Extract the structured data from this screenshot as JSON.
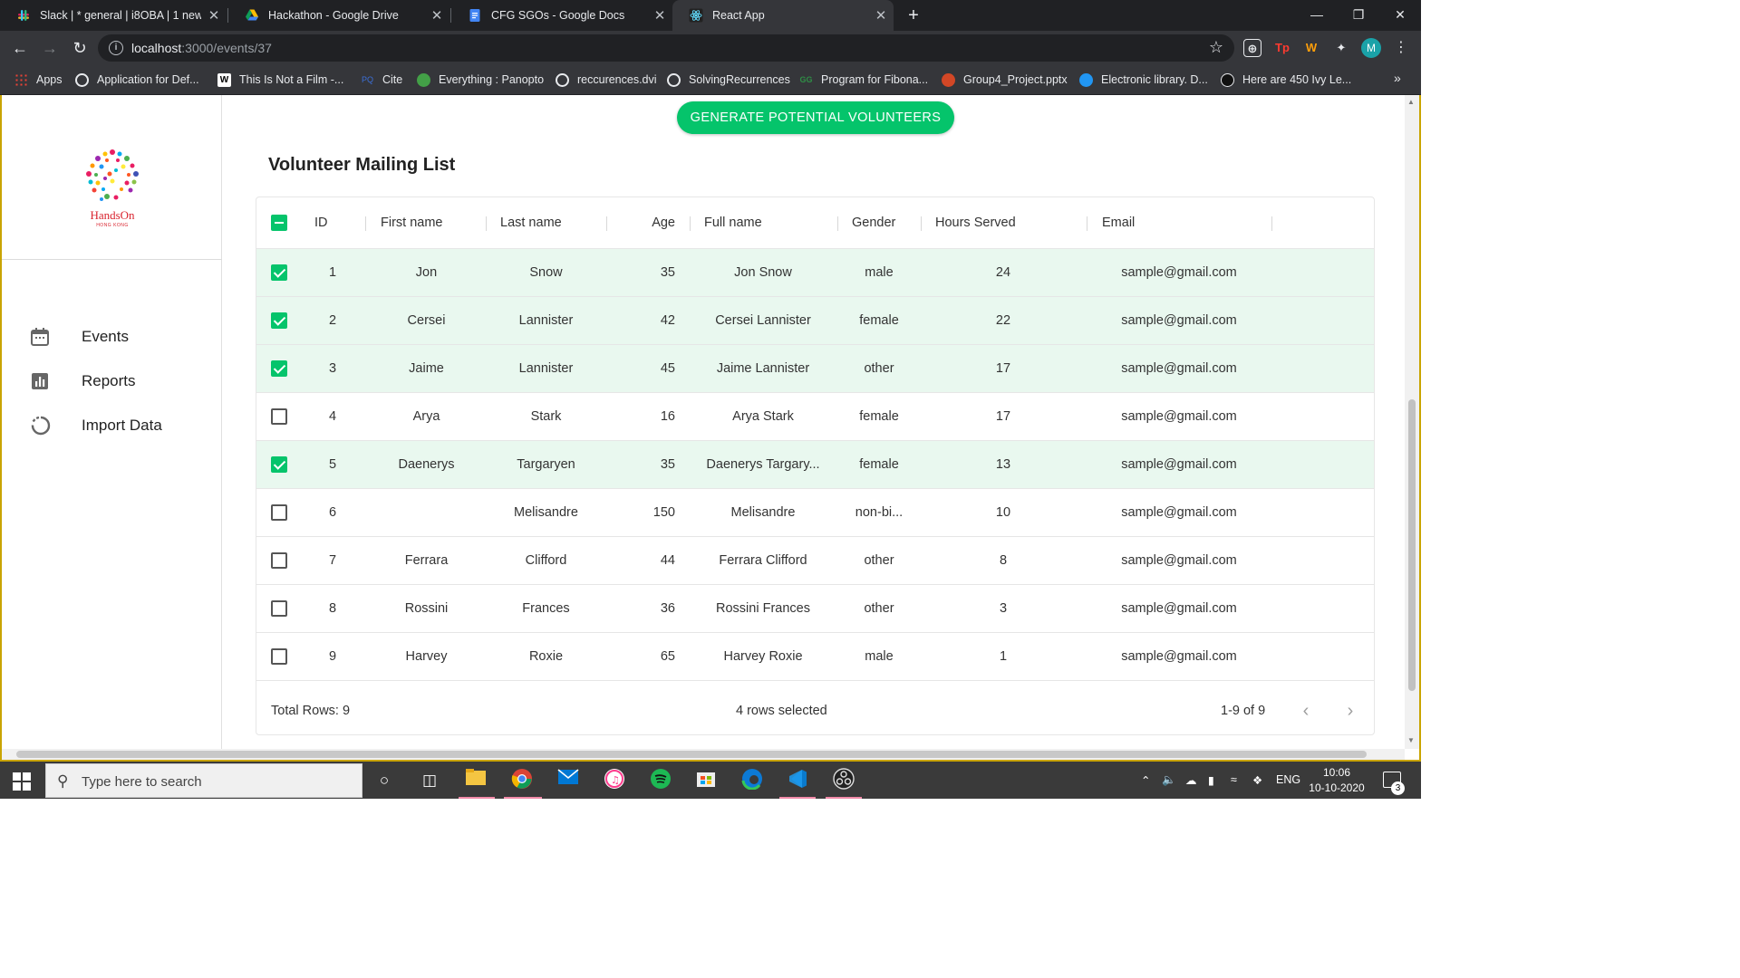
{
  "browser": {
    "tabs": [
      {
        "title": "Slack | * general | i8OBA | 1 new",
        "favicon": "slack-icon"
      },
      {
        "title": "Hackathon - Google Drive",
        "favicon": "google-drive-icon"
      },
      {
        "title": "CFG SGOs - Google Docs",
        "favicon": "google-docs-icon"
      },
      {
        "title": "React App",
        "favicon": "react-icon"
      }
    ],
    "close_glyph": "✕",
    "new_tab_glyph": "+",
    "address": {
      "host": "localhost",
      "path": ":3000/events/37"
    },
    "bookmarks": [
      {
        "label": "Apps"
      },
      {
        "label": "Application for Def..."
      },
      {
        "label": "This Is Not a Film -..."
      },
      {
        "label": "Cite"
      },
      {
        "label": "Everything : Panopto"
      },
      {
        "label": "reccurences.dvi"
      },
      {
        "label": "SolvingRecurrences"
      },
      {
        "label": "Program for Fibona..."
      },
      {
        "label": "Group4_Project.pptx"
      },
      {
        "label": "Electronic library. D..."
      },
      {
        "label": "Here are 450 Ivy Le..."
      }
    ],
    "profile_initial": "M"
  },
  "sidebar": {
    "logo_text": "HandsOn",
    "logo_subtext": "HONG KONG",
    "items": [
      {
        "label": "Events",
        "icon": "calendar-icon"
      },
      {
        "label": "Reports",
        "icon": "bar-chart-icon"
      },
      {
        "label": "Import Data",
        "icon": "progress-circle-icon"
      }
    ]
  },
  "main": {
    "generate_button": "GENERATE POTENTIAL VOLUNTEERS",
    "title": "Volunteer Mailing List",
    "columns": [
      "ID",
      "First name",
      "Last name",
      "Age",
      "Full name",
      "Gender",
      "Hours Served",
      "Email"
    ],
    "rows": [
      {
        "id": "1",
        "first": "Jon",
        "last": "Snow",
        "age": "35",
        "full": "Jon Snow",
        "gender": "male",
        "hours": "24",
        "email": "sample@gmail.com",
        "selected": true
      },
      {
        "id": "2",
        "first": "Cersei",
        "last": "Lannister",
        "age": "42",
        "full": "Cersei Lannister",
        "gender": "female",
        "hours": "22",
        "email": "sample@gmail.com",
        "selected": true
      },
      {
        "id": "3",
        "first": "Jaime",
        "last": "Lannister",
        "age": "45",
        "full": "Jaime Lannister",
        "gender": "other",
        "hours": "17",
        "email": "sample@gmail.com",
        "selected": true
      },
      {
        "id": "4",
        "first": "Arya",
        "last": "Stark",
        "age": "16",
        "full": "Arya Stark",
        "gender": "female",
        "hours": "17",
        "email": "sample@gmail.com",
        "selected": false
      },
      {
        "id": "5",
        "first": "Daenerys",
        "last": "Targaryen",
        "age": "35",
        "full": "Daenerys Targary...",
        "gender": "female",
        "hours": "13",
        "email": "sample@gmail.com",
        "selected": true
      },
      {
        "id": "6",
        "first": "",
        "last": "Melisandre",
        "age": "150",
        "full": "Melisandre",
        "gender": "non-bi...",
        "hours": "10",
        "email": "sample@gmail.com",
        "selected": false
      },
      {
        "id": "7",
        "first": "Ferrara",
        "last": "Clifford",
        "age": "44",
        "full": "Ferrara Clifford",
        "gender": "other",
        "hours": "8",
        "email": "sample@gmail.com",
        "selected": false
      },
      {
        "id": "8",
        "first": "Rossini",
        "last": "Frances",
        "age": "36",
        "full": "Rossini Frances",
        "gender": "other",
        "hours": "3",
        "email": "sample@gmail.com",
        "selected": false
      },
      {
        "id": "9",
        "first": "Harvey",
        "last": "Roxie",
        "age": "65",
        "full": "Harvey Roxie",
        "gender": "male",
        "hours": "1",
        "email": "sample@gmail.com",
        "selected": false
      }
    ],
    "footer": {
      "total": "Total Rows: 9",
      "selected": "4 rows selected",
      "range": "1-9 of 9"
    }
  },
  "taskbar": {
    "search_placeholder": "Type here to search",
    "lang": "ENG",
    "time": "10:06",
    "date": "10-10-2020",
    "notifications": "3"
  },
  "colors": {
    "accent": "#05c46b",
    "selected_row": "#e9f8ef",
    "logo_red": "#d9232e"
  }
}
